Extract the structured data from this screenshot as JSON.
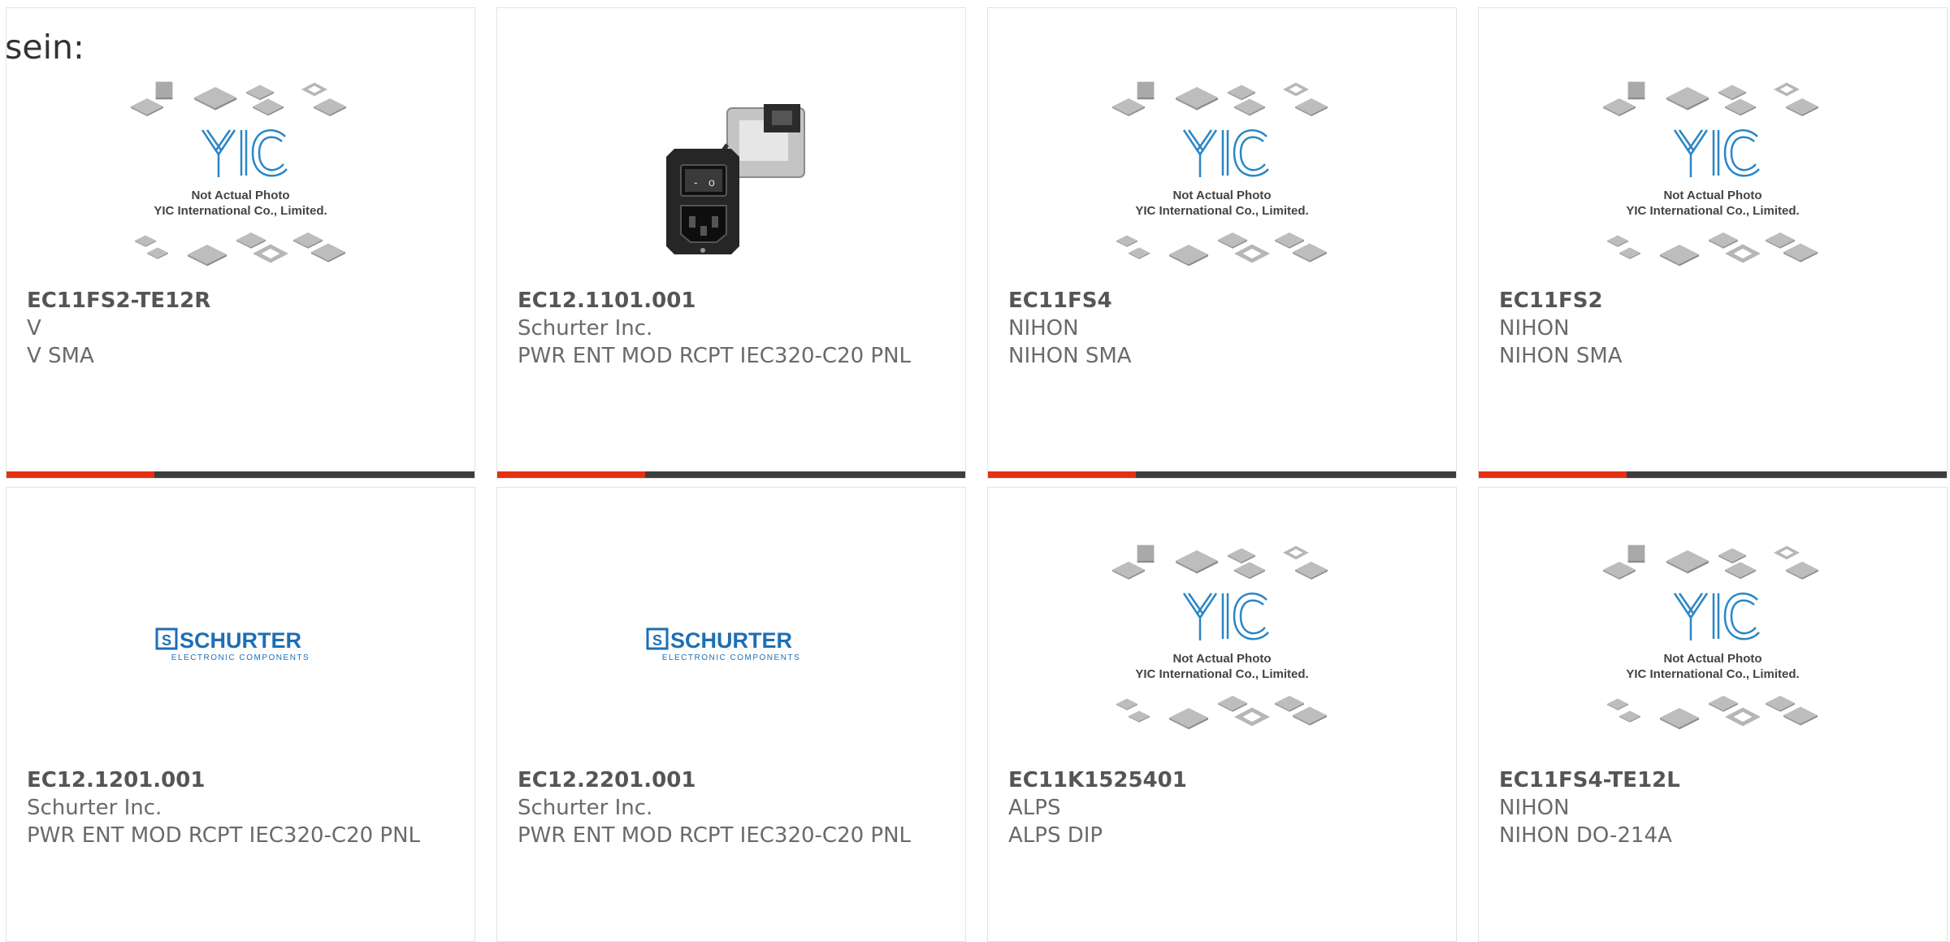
{
  "lead_text": "sein:",
  "placeholder_image": {
    "caption_line1": "Not Actual Photo",
    "caption_line2": "YIC International Co., Limited.",
    "logo_text": "YIC"
  },
  "schurter_logo": {
    "mark": "S",
    "name": "SCHURTER",
    "tagline": "ELECTRONIC COMPONENTS"
  },
  "colors": {
    "accent": "#e63012",
    "bar_dark": "#3d3d3d",
    "yic_blue": "#2a86c6",
    "schurter_blue": "#1c6fb5"
  },
  "products": [
    {
      "part_number": "EC11FS2-TE12R",
      "manufacturer": "V",
      "description": "V SMA",
      "image": "yic-placeholder"
    },
    {
      "part_number": "EC12.1101.001",
      "manufacturer": "Schurter Inc.",
      "description": "PWR ENT MOD RCPT IEC320-C20 PNL",
      "image": "power-entry-module-photo"
    },
    {
      "part_number": "EC11FS4",
      "manufacturer": "NIHON",
      "description": "NIHON SMA",
      "image": "yic-placeholder"
    },
    {
      "part_number": "EC11FS2",
      "manufacturer": "NIHON",
      "description": "NIHON SMA",
      "image": "yic-placeholder"
    },
    {
      "part_number": "EC12.1201.001",
      "manufacturer": "Schurter Inc.",
      "description": "PWR ENT MOD RCPT IEC320-C20 PNL",
      "image": "schurter-logo"
    },
    {
      "part_number": "EC12.2201.001",
      "manufacturer": "Schurter Inc.",
      "description": "PWR ENT MOD RCPT IEC320-C20 PNL",
      "image": "schurter-logo"
    },
    {
      "part_number": "EC11K1525401",
      "manufacturer": "ALPS",
      "description": "ALPS DIP",
      "image": "yic-placeholder"
    },
    {
      "part_number": "EC11FS4-TE12L",
      "manufacturer": "NIHON",
      "description": "NIHON DO-214A",
      "image": "yic-placeholder"
    }
  ]
}
